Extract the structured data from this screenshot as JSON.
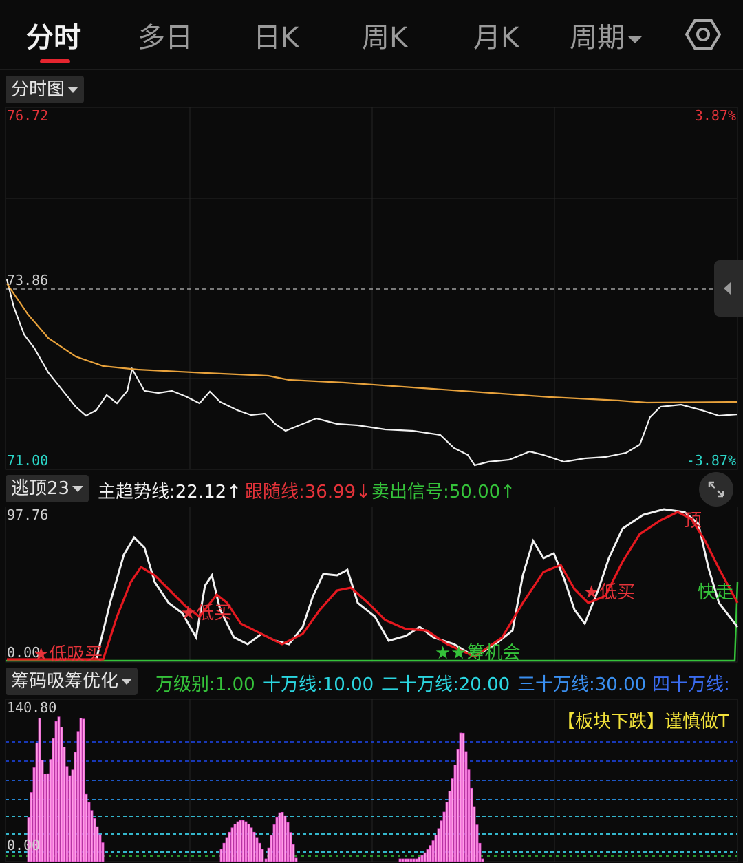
{
  "tabs": [
    {
      "label": "分时",
      "active": true
    },
    {
      "label": "多日",
      "active": false
    },
    {
      "label": "日K",
      "active": false
    },
    {
      "label": "周K",
      "active": false
    },
    {
      "label": "月K",
      "active": false
    },
    {
      "label": "周期",
      "active": false
    }
  ],
  "icons": {
    "settings": "hexagon-gear-icon",
    "dropdown": "caret-down-icon",
    "side": "chevron-left-icon",
    "expand": "expand-arrows-icon"
  },
  "price_panel": {
    "selector": "分时图",
    "max_price": "76.72",
    "max_pct": "3.87%",
    "ref_price": "73.86",
    "min_price": "71.00",
    "min_pct": "-3.87%"
  },
  "indicator_panel": {
    "selector": "逃顶23",
    "main_trend": "主趋势线:22.12↑",
    "follow_line": "跟随线:36.99↓",
    "sell_signal": "卖出信号:50.00↑",
    "max_value": "97.76",
    "min_value": "0.00",
    "signals": [
      "★低吸买",
      "★低买",
      "★★筹机会",
      "★低买",
      "顶",
      "快走"
    ]
  },
  "chips_panel": {
    "selector": "筹码吸筹优化",
    "level": "万级别:1.00",
    "line_100k": "十万线:10.00",
    "line_200k": "二十万线:20.00",
    "line_300k": "三十万线:30.00",
    "line_400k": "四十万线:",
    "max_value": "140.80",
    "min_value": "0.00",
    "warning": "【板块下跌】谨慎做T"
  },
  "colors": {
    "up": "#e5333a",
    "down": "#2bd6c8",
    "avg": "#e8a23c",
    "price": "#f2f2f2",
    "green": "#35c23a",
    "pink": "#ff9de6",
    "magenta": "#e040c8"
  }
}
